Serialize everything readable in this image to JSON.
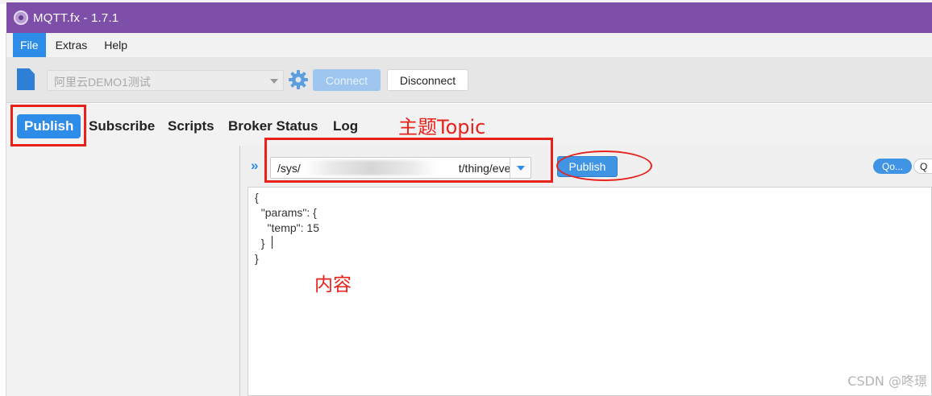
{
  "window": {
    "title": "MQTT.fx - 1.7.1"
  },
  "menu": [
    {
      "label": "File",
      "active": true
    },
    {
      "label": "Extras",
      "active": false
    },
    {
      "label": "Help",
      "active": false
    }
  ],
  "toolbar": {
    "profile_value": "阿里云DEMO1测试",
    "connect_label": "Connect",
    "disconnect_label": "Disconnect"
  },
  "tabs": [
    {
      "label": "Publish",
      "active": true
    },
    {
      "label": "Subscribe",
      "active": false
    },
    {
      "label": "Scripts",
      "active": false
    },
    {
      "label": "Broker Status",
      "active": false
    },
    {
      "label": "Log",
      "active": false
    }
  ],
  "publish": {
    "topic_prefix": "/sys/",
    "topic_suffix": "t/thing/event/pro",
    "publish_label": "Publish",
    "qos_label": "Qo...",
    "qos_label_2": "Q"
  },
  "payload_lines": [
    "{",
    "  \"params\": {",
    "    \"temp\": 15",
    "  }",
    "}"
  ],
  "annotations": {
    "topic_label": "主题Topic",
    "content_label": "内容"
  },
  "watermark": "CSDN @咚璟",
  "colors": {
    "titlebar": "#7d4fa8",
    "accent_blue": "#2d8ce8",
    "annotation_red": "#e8221a"
  }
}
